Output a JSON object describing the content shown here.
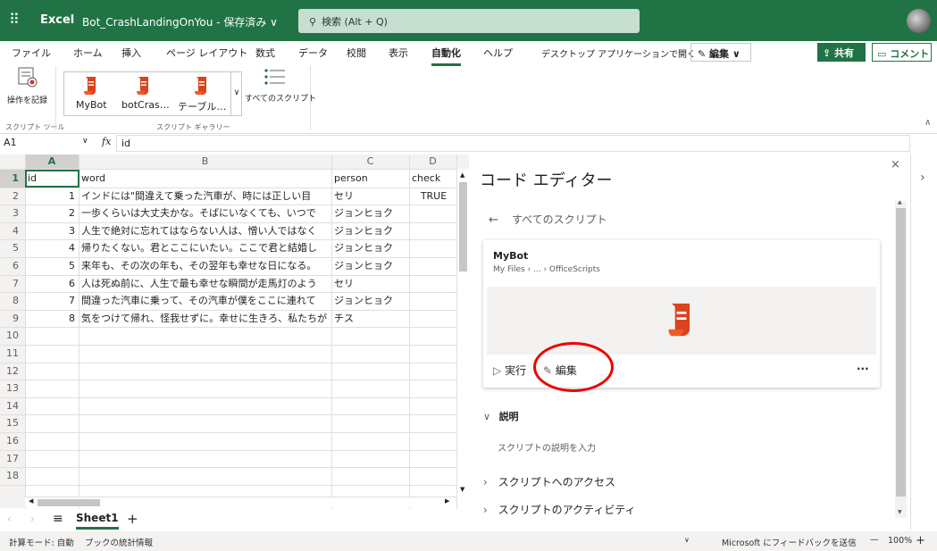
{
  "app": {
    "waffle": "⠿",
    "name": "Excel",
    "document": "Bot_CrashLandingOnYou - 保存済み ∨"
  },
  "search": {
    "placeholder": "検索 (Alt + Q)"
  },
  "menu": {
    "items": [
      "ファイル",
      "ホーム",
      "挿入",
      "ページ レイアウト",
      "数式",
      "データ",
      "校閲",
      "表示",
      "自動化",
      "ヘルプ",
      "デスクトップ アプリケーションで開く"
    ],
    "active": "自動化",
    "edit_mode": "編集 ∨",
    "share": "共有",
    "comment": "コメント"
  },
  "ribbon": {
    "record_label": "操作を記録",
    "script_tools": "スクリプト ツール",
    "gallery": [
      "MyBot",
      "botCras…",
      "テーブル…"
    ],
    "gallery_label": "スクリプト ギャラリー",
    "all_scripts": "すべてのスクリプト"
  },
  "formula": {
    "name_box": "A1",
    "fx": "fx",
    "value": "id"
  },
  "sheet": {
    "columns": [
      "A",
      "B",
      "C",
      "D"
    ],
    "rows": [
      "1",
      "2",
      "3",
      "4",
      "5",
      "6",
      "7",
      "8",
      "9",
      "10",
      "11",
      "12",
      "13",
      "14",
      "15",
      "16",
      "17",
      "18"
    ],
    "header": {
      "a": "id",
      "b": "word",
      "c": "person",
      "d": "check"
    },
    "data": [
      {
        "a": "1",
        "b": "インドには\"間違えて乗った汽車が、時には正しい目",
        "c": "セリ",
        "d": "TRUE"
      },
      {
        "a": "2",
        "b": "一歩くらいは大丈夫かな。そばにいなくても、いつで",
        "c": "ジョンヒョク",
        "d": ""
      },
      {
        "a": "3",
        "b": "人生で絶対に忘れてはならない人は、憎い人ではなく",
        "c": "ジョンヒョク",
        "d": ""
      },
      {
        "a": "4",
        "b": "帰りたくない。君とここにいたい。ここで君と結婚し",
        "c": "ジョンヒョク",
        "d": ""
      },
      {
        "a": "5",
        "b": "来年も、その次の年も、その翌年も幸せな日になる。",
        "c": "ジョンヒョク",
        "d": ""
      },
      {
        "a": "6",
        "b": "人は死ぬ前に、人生で最も幸せな瞬間が走馬灯のよう",
        "c": "セリ",
        "d": ""
      },
      {
        "a": "7",
        "b": "間違った汽車に乗って、その汽車が僕をここに連れて",
        "c": "ジョンヒョク",
        "d": ""
      },
      {
        "a": "8",
        "b": "気をつけて帰れ、怪我せずに。幸せに生きろ、私たちが",
        "c": "チス",
        "d": ""
      }
    ]
  },
  "tabs": {
    "sheet1": "Sheet1",
    "add": "+",
    "menu_icon": "≡"
  },
  "status": {
    "calc_mode": "計算モード: 自動",
    "book_stats": "ブックの統計情報",
    "feedback": "Microsoft にフィードバックを送信",
    "zoom": "100%",
    "zoom_minus": "—",
    "zoom_plus": "+"
  },
  "code_editor": {
    "title": "コード エディター",
    "back": "すべてのスクリプト",
    "script_name": "MyBot",
    "path": "My Files › ... › OfficeScripts",
    "run": "実行",
    "edit": "編集",
    "more": "···",
    "description_header": "説明",
    "description_placeholder": "スクリプトの説明を入力",
    "access": "スクリプトへのアクセス",
    "activity": "スクリプトのアクティビティ"
  },
  "colors": {
    "accent": "#217346",
    "annotation": "#e00000",
    "script_icon": "#d9431e"
  }
}
